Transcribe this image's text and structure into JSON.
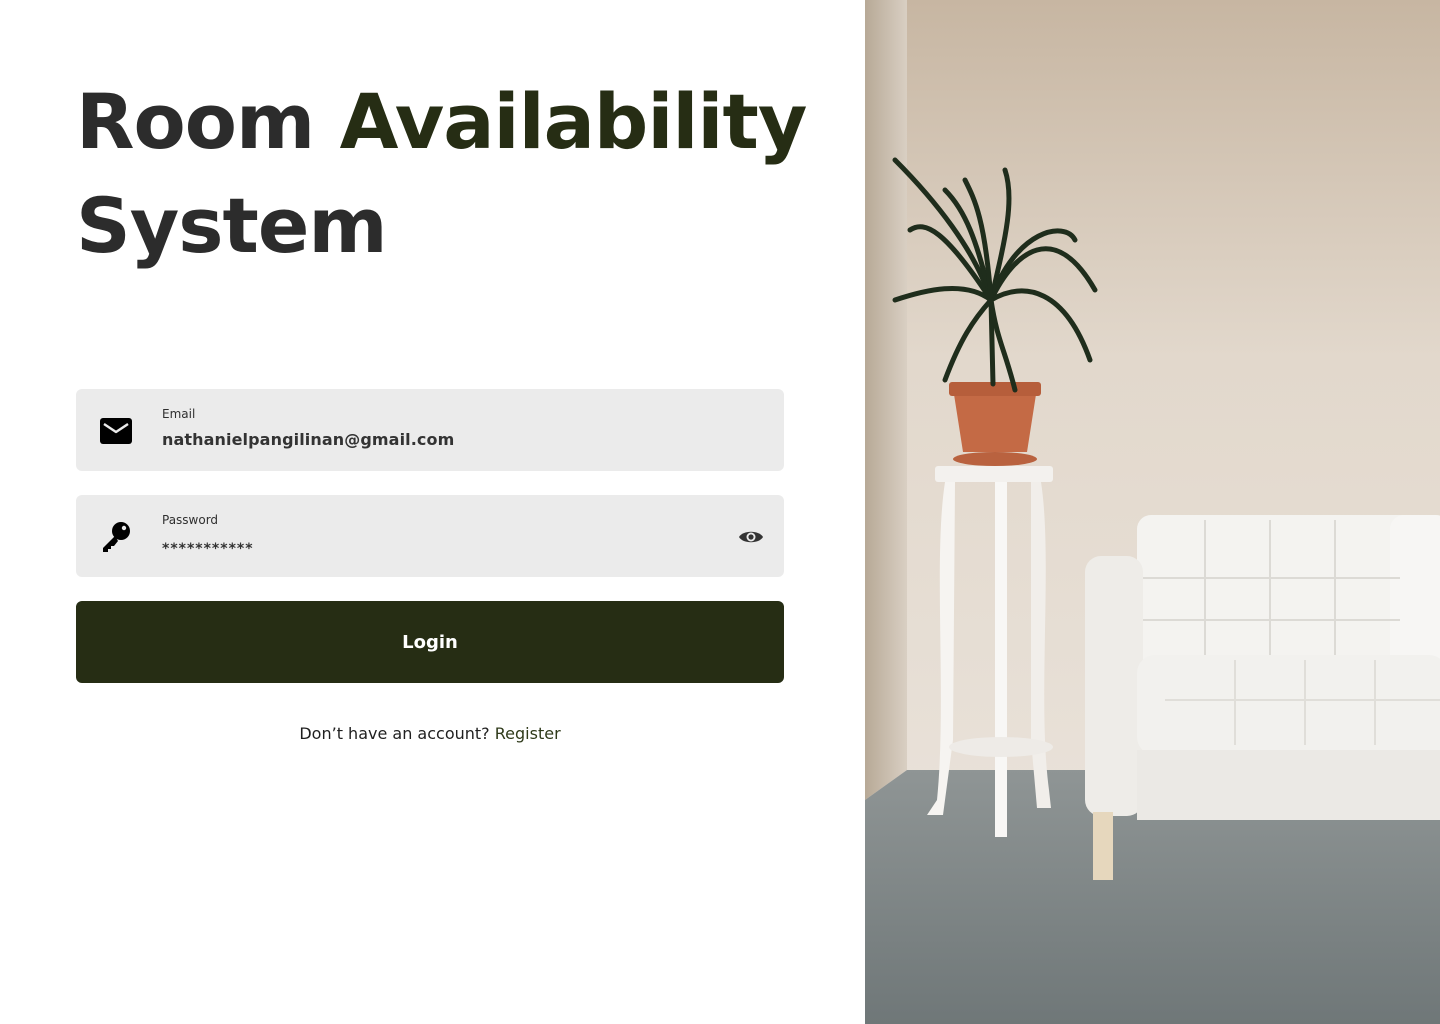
{
  "title": {
    "part1": "Room ",
    "accent": "Availability",
    "part2": "System"
  },
  "email": {
    "label": "Email",
    "value": "nathanielpangilinan@gmail.com",
    "icon": "mail-icon"
  },
  "password": {
    "label": "Password",
    "value": "***********",
    "icon": "key-icon",
    "toggle_icon": "eye-icon"
  },
  "login": {
    "label": "Login"
  },
  "register": {
    "prompt": "Don’t have an account?",
    "link": "Register"
  },
  "colors": {
    "accent": "#262d14",
    "field_bg": "#ebebeb",
    "text": "#2c2c2c"
  }
}
